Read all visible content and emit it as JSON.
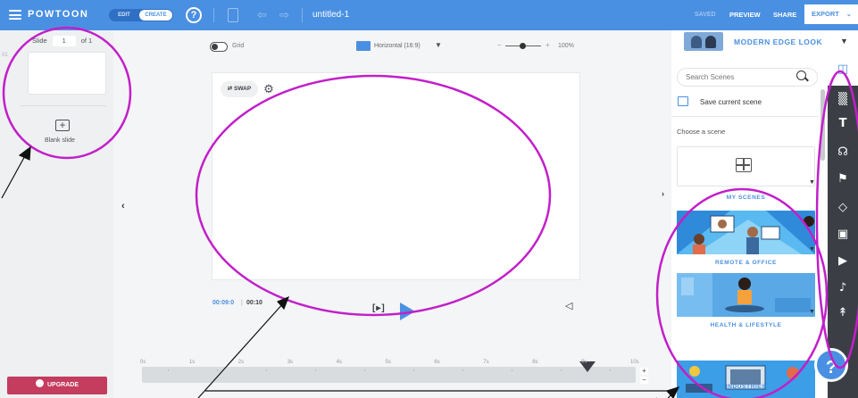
{
  "header": {
    "logo": "POWTOON",
    "mode_edit": "EDIT",
    "mode_create": "CREATE",
    "help": "?",
    "title": "untitled-1",
    "saved": "SAVED",
    "preview": "PREVIEW",
    "share": "SHARE",
    "export": "EXPORT"
  },
  "slides": {
    "label": "Slide",
    "current": "1",
    "of": "of 1",
    "thumb_number": "01",
    "blank_label": "Blank slide",
    "upgrade": "UPGRADE"
  },
  "stage": {
    "grid_label": "Grid",
    "aspect": "Horizontal (16:9)",
    "zoom": "100%",
    "swap": "SWAP"
  },
  "playback": {
    "current_time": "00:09:0",
    "separator": "|",
    "total_time": "00:10"
  },
  "timeline": {
    "ticks": [
      "0s",
      "1s",
      "2s",
      "3s",
      "4s",
      "5s",
      "6s",
      "7s",
      "8s",
      "9s",
      "10s"
    ],
    "playhead_label": "•••"
  },
  "library": {
    "style_name": "MODERN EDGE LOOK",
    "search_placeholder": "Search Scenes",
    "save_scene": "Save current scene",
    "choose_label": "Choose a scene",
    "categories": [
      "MY SCENES",
      "REMOTE & OFFICE",
      "HEALTH & LIFESTYLE",
      "INDUSTRIES"
    ]
  },
  "toolbar": {
    "icons": [
      "layout-icon",
      "background-icon",
      "text-icon",
      "characters-icon",
      "props-icon",
      "shapes-icon",
      "media-icon",
      "video-icon",
      "music-icon",
      "cursor-icon"
    ]
  },
  "help_fab": "?",
  "colors": {
    "topbar": "#4a90e2",
    "toolbar": "#3b3f45",
    "upgrade": "#c43c5e",
    "annotation": "#c21fc9"
  }
}
